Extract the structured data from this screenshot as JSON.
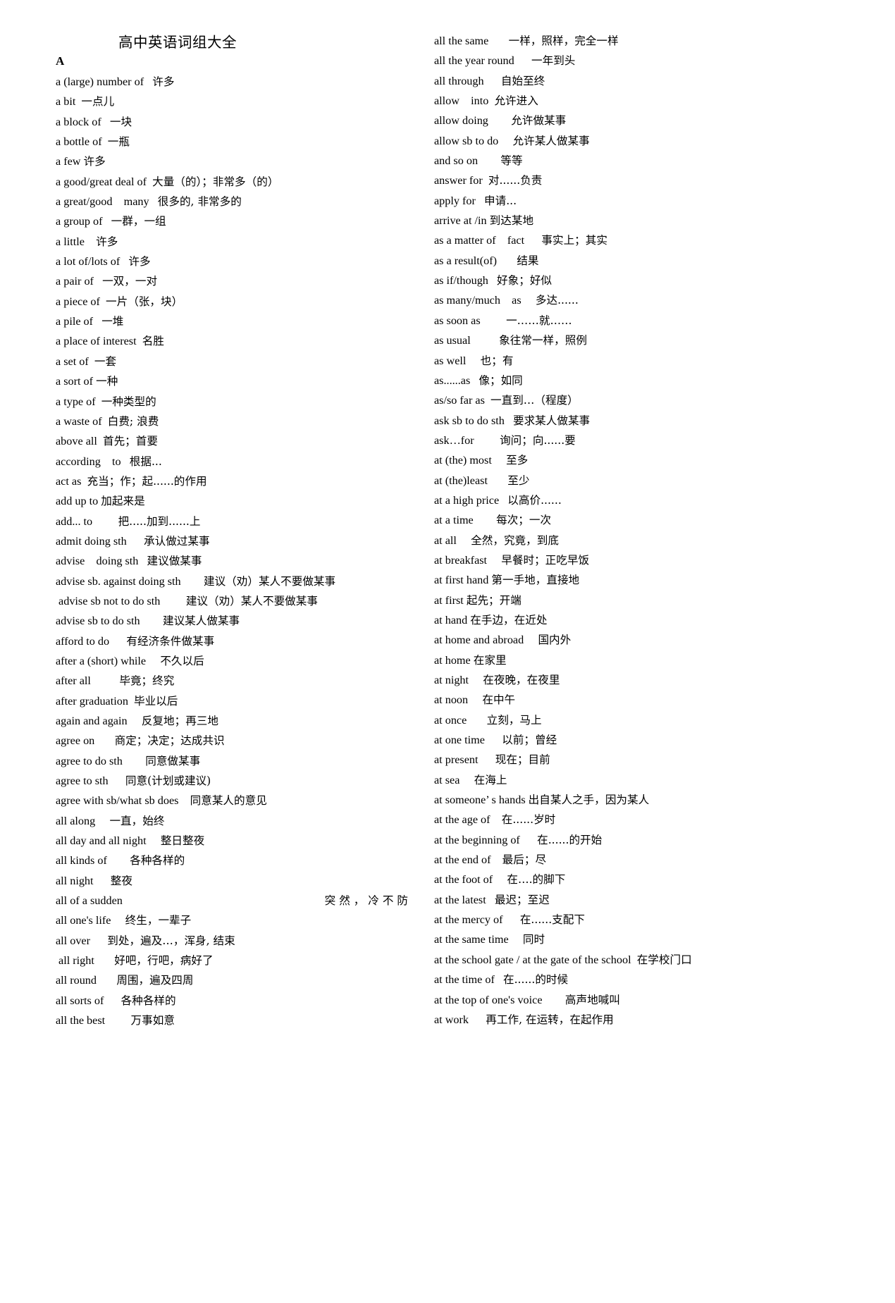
{
  "document": {
    "title": "高中英语词组大全",
    "section_letter": "A"
  },
  "left_column": [
    {
      "en": "a (large) number of",
      "gap": "   ",
      "zh": "许多"
    },
    {
      "en": "a bit",
      "gap": "  ",
      "zh": "一点儿"
    },
    {
      "en": "a block of",
      "gap": "   ",
      "zh": "一块"
    },
    {
      "en": "a bottle of",
      "gap": "  ",
      "zh": "一瓶"
    },
    {
      "en": "a few",
      "gap": " ",
      "zh": "许多"
    },
    {
      "en": "a good/great deal of",
      "gap": "  ",
      "zh": "大量（的）；非常多（的）"
    },
    {
      "en": "a great/good    many",
      "gap": "   ",
      "zh": "很多的, 非常多的"
    },
    {
      "en": "a group of",
      "gap": "   ",
      "zh": "一群，一组"
    },
    {
      "en": "a little",
      "gap": "    ",
      "zh": "许多"
    },
    {
      "en": "a lot of/lots of",
      "gap": "   ",
      "zh": "许多"
    },
    {
      "en": "a pair of",
      "gap": "   ",
      "zh": "一双，一对"
    },
    {
      "en": "a piece of",
      "gap": "  ",
      "zh": "一片（张，块）"
    },
    {
      "en": "a pile of",
      "gap": "   ",
      "zh": "一堆"
    },
    {
      "en": "a place of interest",
      "gap": "  ",
      "zh": "名胜"
    },
    {
      "en": "a set of",
      "gap": "  ",
      "zh": "一套"
    },
    {
      "en": "a sort of",
      "gap": " ",
      "zh": "一种"
    },
    {
      "en": "a type of",
      "gap": "  ",
      "zh": "一种类型的"
    },
    {
      "en": "a waste of",
      "gap": "  ",
      "zh": "白费; 浪费"
    },
    {
      "en": "above all",
      "gap": "  ",
      "zh": "首先；首要"
    },
    {
      "en": "according    to",
      "gap": "   ",
      "zh": "根据..."
    },
    {
      "en": "act as",
      "gap": "  ",
      "zh": "充当；作；起......的作用"
    },
    {
      "en": "add up to",
      "gap": " ",
      "zh": "加起来是"
    },
    {
      "en": "add... to",
      "gap": "         ",
      "zh": "把.....加到......上"
    },
    {
      "en": "admit doing sth",
      "gap": "      ",
      "zh": "承认做过某事"
    },
    {
      "en": "advise    doing sth",
      "gap": "   ",
      "zh": "建议做某事"
    },
    {
      "en": "advise sb. against doing sth",
      "gap": "        ",
      "zh": "建议（劝）某人不要做某事"
    },
    {
      "en": " advise sb not to do sth",
      "gap": "         ",
      "zh": "建议（劝）某人不要做某事"
    },
    {
      "en": "advise sb to do sth",
      "gap": "        ",
      "zh": "建议某人做某事"
    },
    {
      "en": "afford to do",
      "gap": "      ",
      "zh": "有经济条件做某事"
    },
    {
      "en": "after a (short) while",
      "gap": "     ",
      "zh": "不久以后"
    },
    {
      "en": "after all",
      "gap": "          ",
      "zh": "毕竟；终究"
    },
    {
      "en": "after graduation",
      "gap": "  ",
      "zh": "毕业以后"
    },
    {
      "en": "again and again",
      "gap": "     ",
      "zh": "反复地；再三地"
    },
    {
      "en": "agree on",
      "gap": "       ",
      "zh": "商定；决定；达成共识"
    },
    {
      "en": "agree to do sth",
      "gap": "        ",
      "zh": "同意做某事"
    },
    {
      "en": "agree to sth",
      "gap": "      ",
      "zh": "同意(计划或建议)"
    },
    {
      "en": "agree with sb/what sb does",
      "gap": "    ",
      "zh": "同意某人的意见"
    },
    {
      "en": "all along",
      "gap": "     ",
      "zh": "一直，始终"
    },
    {
      "en": "all day and all night",
      "gap": "     ",
      "zh": "整日整夜"
    },
    {
      "en": "all kinds of",
      "gap": "        ",
      "zh": "各种各样的"
    },
    {
      "en": "all night",
      "gap": "      ",
      "zh": "整夜"
    },
    {
      "en": "all    of    a    sudden",
      "gap": "",
      "zh": "突 然 ， 冷 不 防",
      "justified": true
    },
    {
      "en": "all one's life",
      "gap": "     ",
      "zh": "终生，一辈子"
    },
    {
      "en": "all over",
      "gap": "      ",
      "zh": "到处，遍及…，浑身, 结束"
    },
    {
      "en": " all right",
      "gap": "       ",
      "zh": "好吧，行吧，病好了"
    },
    {
      "en": "all round",
      "gap": "       ",
      "zh": "周围，遍及四周"
    },
    {
      "en": "all sorts of",
      "gap": "      ",
      "zh": "各种各样的"
    },
    {
      "en": "all the best",
      "gap": "         ",
      "zh": "万事如意"
    }
  ],
  "right_column": [
    {
      "en": "all the same",
      "gap": "       ",
      "zh": "一样，照样，完全一样"
    },
    {
      "en": "all the year round",
      "gap": "      ",
      "zh": "一年到头"
    },
    {
      "en": "all through",
      "gap": "      ",
      "zh": "自始至终"
    },
    {
      "en": "allow    into",
      "gap": "  ",
      "zh": "允许进入"
    },
    {
      "en": "allow doing",
      "gap": "        ",
      "zh": "允许做某事"
    },
    {
      "en": "allow sb to do",
      "gap": "     ",
      "zh": "允许某人做某事"
    },
    {
      "en": "and so on",
      "gap": "        ",
      "zh": "等等"
    },
    {
      "en": "answer for",
      "gap": "  ",
      "zh": "对......负责"
    },
    {
      "en": "apply for",
      "gap": "   ",
      "zh": "申请..."
    },
    {
      "en": "arrive at /in",
      "gap": " ",
      "zh": "到达某地"
    },
    {
      "en": "as a matter of    fact",
      "gap": "      ",
      "zh": "事实上；其实"
    },
    {
      "en": "as a result(of)",
      "gap": "       ",
      "zh": "结果"
    },
    {
      "en": "as if/though",
      "gap": "   ",
      "zh": "好象；好似"
    },
    {
      "en": "as many/much    as",
      "gap": "     ",
      "zh": "多达......"
    },
    {
      "en": "as soon as",
      "gap": "         ",
      "zh": "一……就……"
    },
    {
      "en": "as usual",
      "gap": "          ",
      "zh": "象往常一样，照例"
    },
    {
      "en": "as well",
      "gap": "     ",
      "zh": "也；有"
    },
    {
      "en": "as......as",
      "gap": "   ",
      "zh": "像；如同"
    },
    {
      "en": "as/so far as",
      "gap": "  ",
      "zh": "一直到…（程度）"
    },
    {
      "en": "ask sb to do sth",
      "gap": "   ",
      "zh": "要求某人做某事"
    },
    {
      "en": "ask…for",
      "gap": "         ",
      "zh": "询问；向......要"
    },
    {
      "en": "at (the) most",
      "gap": "     ",
      "zh": "至多"
    },
    {
      "en": "at (the)least",
      "gap": "       ",
      "zh": "至少"
    },
    {
      "en": "at a high price",
      "gap": "   ",
      "zh": "以高价......"
    },
    {
      "en": "at a time",
      "gap": "        ",
      "zh": "每次；一次"
    },
    {
      "en": "at all",
      "gap": "     ",
      "zh": "全然，究竟，到底"
    },
    {
      "en": "at breakfast",
      "gap": "     ",
      "zh": "早餐时；正吃早饭"
    },
    {
      "en": "at first hand",
      "gap": " ",
      "zh": "第一手地，直接地"
    },
    {
      "en": "at first",
      "gap": " ",
      "zh": "起先；开端"
    },
    {
      "en": "at hand",
      "gap": " ",
      "zh": "在手边，在近处"
    },
    {
      "en": "at home and abroad",
      "gap": "     ",
      "zh": "国内外"
    },
    {
      "en": "at home",
      "gap": " ",
      "zh": "在家里"
    },
    {
      "en": "at night",
      "gap": "     ",
      "zh": "在夜晚，在夜里"
    },
    {
      "en": "at noon",
      "gap": "     ",
      "zh": "在中午"
    },
    {
      "en": "at once",
      "gap": "       ",
      "zh": "立刻，马上"
    },
    {
      "en": "at one time",
      "gap": "      ",
      "zh": "以前；曾经"
    },
    {
      "en": "at present",
      "gap": "      ",
      "zh": "现在；目前"
    },
    {
      "en": "at sea",
      "gap": "     ",
      "zh": "在海上"
    },
    {
      "en": "at someone’ s hands",
      "gap": " ",
      "zh": "出自某人之手，因为某人"
    },
    {
      "en": "at the age of",
      "gap": "    ",
      "zh": "在......岁时"
    },
    {
      "en": "at the beginning of",
      "gap": "      ",
      "zh": "在......的开始"
    },
    {
      "en": "at the end of",
      "gap": "    ",
      "zh": "最后；尽"
    },
    {
      "en": "at the foot of",
      "gap": "     ",
      "zh": "在….的脚下"
    },
    {
      "en": "at the latest",
      "gap": "   ",
      "zh": "最迟；至迟"
    },
    {
      "en": "at the mercy of",
      "gap": "      ",
      "zh": "在......支配下"
    },
    {
      "en": "at the same time",
      "gap": "     ",
      "zh": "同时"
    },
    {
      "en": "at the school gate / at the gate of the school",
      "gap": "  ",
      "zh": "在学校门口"
    },
    {
      "en": "at the time of",
      "gap": "   ",
      "zh": "在......的时候"
    },
    {
      "en": "at the top of one's voice",
      "gap": "        ",
      "zh": "高声地喊叫"
    },
    {
      "en": "at work",
      "gap": "      ",
      "zh": "再工作, 在运转，在起作用"
    }
  ]
}
